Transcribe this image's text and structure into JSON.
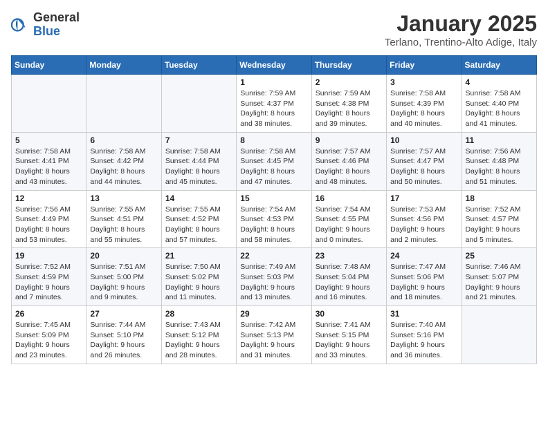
{
  "logo": {
    "general": "General",
    "blue": "Blue"
  },
  "header": {
    "month": "January 2025",
    "location": "Terlano, Trentino-Alto Adige, Italy"
  },
  "weekdays": [
    "Sunday",
    "Monday",
    "Tuesday",
    "Wednesday",
    "Thursday",
    "Friday",
    "Saturday"
  ],
  "weeks": [
    [
      {
        "day": "",
        "sunrise": "",
        "sunset": "",
        "daylight": ""
      },
      {
        "day": "",
        "sunrise": "",
        "sunset": "",
        "daylight": ""
      },
      {
        "day": "",
        "sunrise": "",
        "sunset": "",
        "daylight": ""
      },
      {
        "day": "1",
        "sunrise": "Sunrise: 7:59 AM",
        "sunset": "Sunset: 4:37 PM",
        "daylight": "Daylight: 8 hours and 38 minutes."
      },
      {
        "day": "2",
        "sunrise": "Sunrise: 7:59 AM",
        "sunset": "Sunset: 4:38 PM",
        "daylight": "Daylight: 8 hours and 39 minutes."
      },
      {
        "day": "3",
        "sunrise": "Sunrise: 7:58 AM",
        "sunset": "Sunset: 4:39 PM",
        "daylight": "Daylight: 8 hours and 40 minutes."
      },
      {
        "day": "4",
        "sunrise": "Sunrise: 7:58 AM",
        "sunset": "Sunset: 4:40 PM",
        "daylight": "Daylight: 8 hours and 41 minutes."
      }
    ],
    [
      {
        "day": "5",
        "sunrise": "Sunrise: 7:58 AM",
        "sunset": "Sunset: 4:41 PM",
        "daylight": "Daylight: 8 hours and 43 minutes."
      },
      {
        "day": "6",
        "sunrise": "Sunrise: 7:58 AM",
        "sunset": "Sunset: 4:42 PM",
        "daylight": "Daylight: 8 hours and 44 minutes."
      },
      {
        "day": "7",
        "sunrise": "Sunrise: 7:58 AM",
        "sunset": "Sunset: 4:44 PM",
        "daylight": "Daylight: 8 hours and 45 minutes."
      },
      {
        "day": "8",
        "sunrise": "Sunrise: 7:58 AM",
        "sunset": "Sunset: 4:45 PM",
        "daylight": "Daylight: 8 hours and 47 minutes."
      },
      {
        "day": "9",
        "sunrise": "Sunrise: 7:57 AM",
        "sunset": "Sunset: 4:46 PM",
        "daylight": "Daylight: 8 hours and 48 minutes."
      },
      {
        "day": "10",
        "sunrise": "Sunrise: 7:57 AM",
        "sunset": "Sunset: 4:47 PM",
        "daylight": "Daylight: 8 hours and 50 minutes."
      },
      {
        "day": "11",
        "sunrise": "Sunrise: 7:56 AM",
        "sunset": "Sunset: 4:48 PM",
        "daylight": "Daylight: 8 hours and 51 minutes."
      }
    ],
    [
      {
        "day": "12",
        "sunrise": "Sunrise: 7:56 AM",
        "sunset": "Sunset: 4:49 PM",
        "daylight": "Daylight: 8 hours and 53 minutes."
      },
      {
        "day": "13",
        "sunrise": "Sunrise: 7:55 AM",
        "sunset": "Sunset: 4:51 PM",
        "daylight": "Daylight: 8 hours and 55 minutes."
      },
      {
        "day": "14",
        "sunrise": "Sunrise: 7:55 AM",
        "sunset": "Sunset: 4:52 PM",
        "daylight": "Daylight: 8 hours and 57 minutes."
      },
      {
        "day": "15",
        "sunrise": "Sunrise: 7:54 AM",
        "sunset": "Sunset: 4:53 PM",
        "daylight": "Daylight: 8 hours and 58 minutes."
      },
      {
        "day": "16",
        "sunrise": "Sunrise: 7:54 AM",
        "sunset": "Sunset: 4:55 PM",
        "daylight": "Daylight: 9 hours and 0 minutes."
      },
      {
        "day": "17",
        "sunrise": "Sunrise: 7:53 AM",
        "sunset": "Sunset: 4:56 PM",
        "daylight": "Daylight: 9 hours and 2 minutes."
      },
      {
        "day": "18",
        "sunrise": "Sunrise: 7:52 AM",
        "sunset": "Sunset: 4:57 PM",
        "daylight": "Daylight: 9 hours and 5 minutes."
      }
    ],
    [
      {
        "day": "19",
        "sunrise": "Sunrise: 7:52 AM",
        "sunset": "Sunset: 4:59 PM",
        "daylight": "Daylight: 9 hours and 7 minutes."
      },
      {
        "day": "20",
        "sunrise": "Sunrise: 7:51 AM",
        "sunset": "Sunset: 5:00 PM",
        "daylight": "Daylight: 9 hours and 9 minutes."
      },
      {
        "day": "21",
        "sunrise": "Sunrise: 7:50 AM",
        "sunset": "Sunset: 5:02 PM",
        "daylight": "Daylight: 9 hours and 11 minutes."
      },
      {
        "day": "22",
        "sunrise": "Sunrise: 7:49 AM",
        "sunset": "Sunset: 5:03 PM",
        "daylight": "Daylight: 9 hours and 13 minutes."
      },
      {
        "day": "23",
        "sunrise": "Sunrise: 7:48 AM",
        "sunset": "Sunset: 5:04 PM",
        "daylight": "Daylight: 9 hours and 16 minutes."
      },
      {
        "day": "24",
        "sunrise": "Sunrise: 7:47 AM",
        "sunset": "Sunset: 5:06 PM",
        "daylight": "Daylight: 9 hours and 18 minutes."
      },
      {
        "day": "25",
        "sunrise": "Sunrise: 7:46 AM",
        "sunset": "Sunset: 5:07 PM",
        "daylight": "Daylight: 9 hours and 21 minutes."
      }
    ],
    [
      {
        "day": "26",
        "sunrise": "Sunrise: 7:45 AM",
        "sunset": "Sunset: 5:09 PM",
        "daylight": "Daylight: 9 hours and 23 minutes."
      },
      {
        "day": "27",
        "sunrise": "Sunrise: 7:44 AM",
        "sunset": "Sunset: 5:10 PM",
        "daylight": "Daylight: 9 hours and 26 minutes."
      },
      {
        "day": "28",
        "sunrise": "Sunrise: 7:43 AM",
        "sunset": "Sunset: 5:12 PM",
        "daylight": "Daylight: 9 hours and 28 minutes."
      },
      {
        "day": "29",
        "sunrise": "Sunrise: 7:42 AM",
        "sunset": "Sunset: 5:13 PM",
        "daylight": "Daylight: 9 hours and 31 minutes."
      },
      {
        "day": "30",
        "sunrise": "Sunrise: 7:41 AM",
        "sunset": "Sunset: 5:15 PM",
        "daylight": "Daylight: 9 hours and 33 minutes."
      },
      {
        "day": "31",
        "sunrise": "Sunrise: 7:40 AM",
        "sunset": "Sunset: 5:16 PM",
        "daylight": "Daylight: 9 hours and 36 minutes."
      },
      {
        "day": "",
        "sunrise": "",
        "sunset": "",
        "daylight": ""
      }
    ]
  ]
}
